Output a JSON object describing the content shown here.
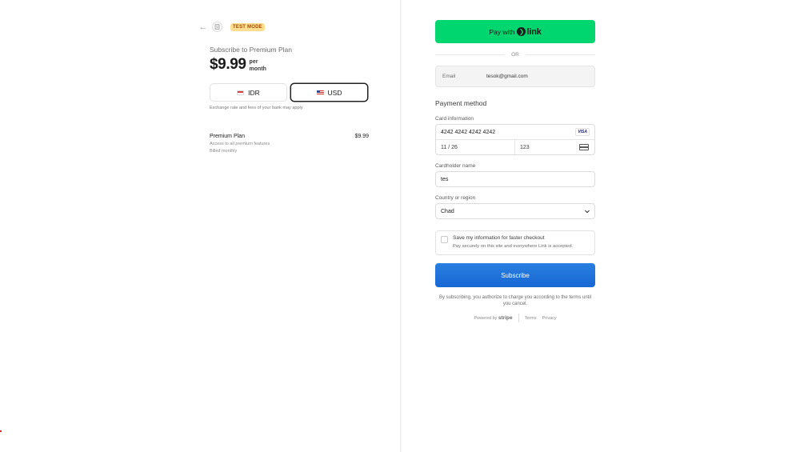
{
  "left": {
    "back_icon": "arrow-left-icon",
    "merchant_icon": "store-icon",
    "test_mode_badge": "TEST MODE",
    "subscribe_title": "Subscribe to Premium Plan",
    "price": "$9.99",
    "price_period": "per month",
    "currencies": [
      {
        "code": "IDR",
        "flag": "flag-indonesia-icon",
        "selected": false
      },
      {
        "code": "USD",
        "flag": "flag-us-icon",
        "selected": true
      }
    ],
    "exchange_note": "Exchange rate and fees of your bank may apply",
    "line_item": {
      "name": "Premium Plan",
      "amount": "$9.99",
      "description": "Access to all premium features",
      "billing": "Billed monthly"
    }
  },
  "right": {
    "pay_with_label": "Pay with",
    "link_brand": "link",
    "or_label": "OR",
    "email": {
      "label": "Email",
      "value": "tesok@gmail.com"
    },
    "payment_method_title": "Payment method",
    "card_info_label": "Card information",
    "card_number": "4242 4242 4242 4242",
    "card_brand": "VISA",
    "card_expiry": "11 / 26",
    "card_cvc": "123",
    "cardholder_label": "Cardholder name",
    "cardholder_value": "tes",
    "country_label": "Country or region",
    "country_value": "Chad",
    "save_info_title": "Save my information for faster checkout",
    "save_info_sub": "Pay securely on this site and everywhere Link is accepted.",
    "subscribe_button": "Subscribe",
    "legal_text": "By subscribing, you authorize to charge you according to the terms until you cancel.",
    "powered_by": "Powered by",
    "stripe": "stripe",
    "terms": "Terms",
    "privacy": "Privacy"
  },
  "colors": {
    "link_green": "#00d66f",
    "subscribe_blue": "#1767d4",
    "test_badge_bg": "#ffde92",
    "test_badge_text": "#a14b00"
  }
}
